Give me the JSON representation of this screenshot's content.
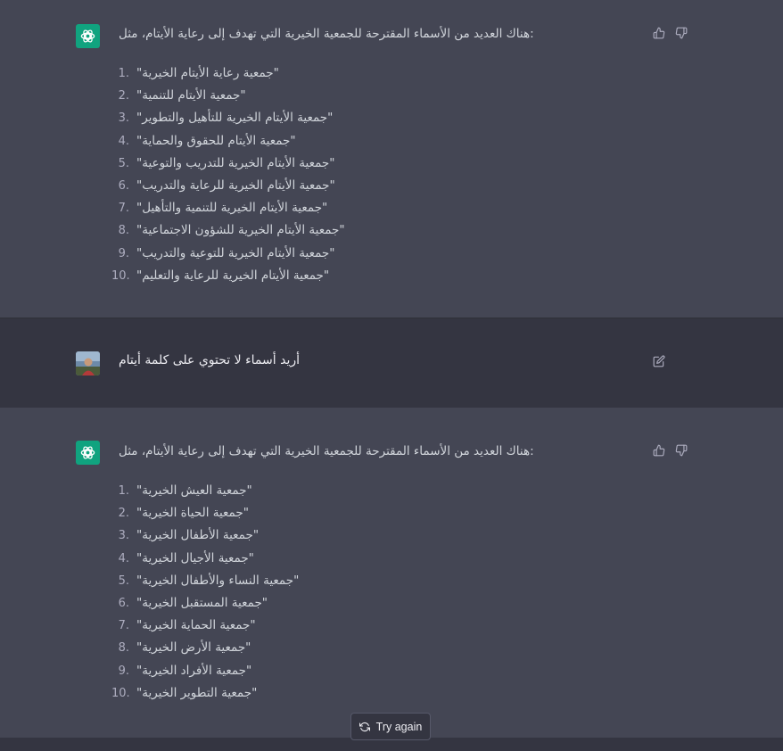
{
  "conversation": {
    "response_1": {
      "intro": "هناك العديد من الأسماء المقترحة للجمعية الخيرية التي تهدف إلى رعاية الأيتام، مثل:",
      "items": [
        {
          "num": "1.",
          "text": "\"جمعية رعاية الأيتام الخيرية\""
        },
        {
          "num": "2.",
          "text": "\"جمعية الأيتام للتنمية\""
        },
        {
          "num": "3.",
          "text": "\"جمعية الأيتام الخيرية للتأهيل والتطوير\""
        },
        {
          "num": "4.",
          "text": "\"جمعية الأيتام للحقوق والحماية\""
        },
        {
          "num": "5.",
          "text": "\"جمعية الأيتام الخيرية للتدريب والتوعية\""
        },
        {
          "num": "6.",
          "text": "\"جمعية الأيتام الخيرية للرعاية والتدريب\""
        },
        {
          "num": "7.",
          "text": "\"جمعية الأيتام الخيرية للتنمية والتأهيل\""
        },
        {
          "num": "8.",
          "text": "\"جمعية الأيتام الخيرية للشؤون الاجتماعية\""
        },
        {
          "num": "9.",
          "text": "\"جمعية الأيتام الخيرية للتوعية والتدريب\""
        },
        {
          "num": "10.",
          "text": "\"جمعية الأيتام الخيرية للرعاية والتعليم\""
        }
      ]
    },
    "user_message": {
      "text": "أريد أسماء لا تحتوي على كلمة أيتام"
    },
    "response_2": {
      "intro": "هناك العديد من الأسماء المقترحة للجمعية الخيرية التي تهدف إلى رعاية الأيتام، مثل:",
      "items": [
        {
          "num": "1.",
          "text": "\"جمعية العيش الخيرية\""
        },
        {
          "num": "2.",
          "text": "\"جمعية الحياة الخيرية\""
        },
        {
          "num": "3.",
          "text": "\"جمعية الأطفال الخيرية\""
        },
        {
          "num": "4.",
          "text": "\"جمعية الأجيال الخيرية\""
        },
        {
          "num": "5.",
          "text": "\"جمعية النساء والأطفال الخيرية\""
        },
        {
          "num": "6.",
          "text": "\"جمعية المستقبل الخيرية\""
        },
        {
          "num": "7.",
          "text": "\"جمعية الحماية الخيرية\""
        },
        {
          "num": "8.",
          "text": "\"جمعية الأرض الخيرية\""
        },
        {
          "num": "9.",
          "text": "\"جمعية الأفراد الخيرية\""
        },
        {
          "num": "10.",
          "text": "\"جمعية التطوير الخيرية\""
        }
      ]
    }
  },
  "controls": {
    "try_again_label": "Try again"
  },
  "icons": {
    "assistant_avatar": "openai-logo-icon",
    "thumbs_up": "thumbs-up-icon",
    "thumbs_down": "thumbs-down-icon",
    "edit": "edit-icon",
    "regenerate": "refresh-icon"
  },
  "colors": {
    "assistant_bg": "#444654",
    "user_bg": "#343541",
    "avatar_green": "#10a37f",
    "text": "#d1d5db"
  }
}
